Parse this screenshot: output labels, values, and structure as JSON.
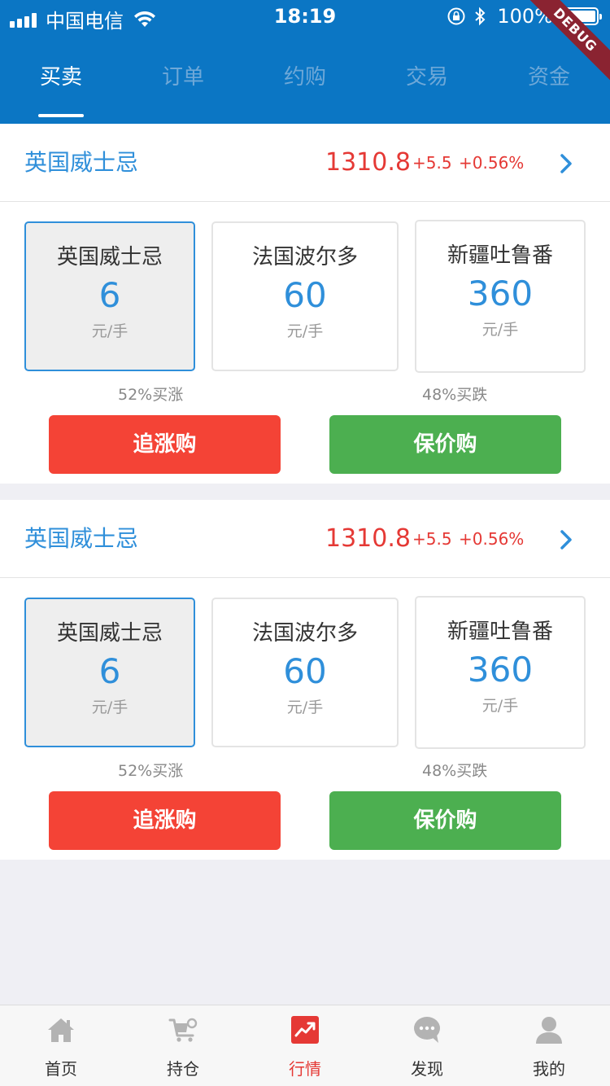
{
  "status_bar": {
    "carrier": "中国电信",
    "time": "18:19",
    "battery": "100%",
    "debug_label": "DEBUG"
  },
  "tabs": [
    {
      "label": "买卖",
      "active": true
    },
    {
      "label": "订单",
      "active": false
    },
    {
      "label": "约购",
      "active": false
    },
    {
      "label": "交易",
      "active": false
    },
    {
      "label": "资金",
      "active": false
    }
  ],
  "cards": [
    {
      "product": "英国威士忌",
      "price": "1310.8",
      "change": "+5.5",
      "change_pct": "+0.56%",
      "options": [
        {
          "name": "英国威士忌",
          "price": "6",
          "unit": "元/手",
          "selected": true
        },
        {
          "name": "法国波尔多",
          "price": "60",
          "unit": "元/手",
          "selected": false
        },
        {
          "name": "新疆吐鲁番",
          "price": "360",
          "unit": "元/手",
          "selected": false
        }
      ],
      "buy_up_ratio": "52%买涨",
      "buy_down_ratio": "48%买跌",
      "buy_up_button": "追涨购",
      "buy_down_button": "保价购"
    },
    {
      "product": "英国威士忌",
      "price": "1310.8",
      "change": "+5.5",
      "change_pct": "+0.56%",
      "options": [
        {
          "name": "英国威士忌",
          "price": "6",
          "unit": "元/手",
          "selected": true
        },
        {
          "name": "法国波尔多",
          "price": "60",
          "unit": "元/手",
          "selected": false
        },
        {
          "name": "新疆吐鲁番",
          "price": "360",
          "unit": "元/手",
          "selected": false
        }
      ],
      "buy_up_ratio": "52%买涨",
      "buy_down_ratio": "48%买跌",
      "buy_up_button": "追涨购",
      "buy_down_button": "保价购"
    }
  ],
  "bottom_nav": [
    {
      "label": "首页",
      "icon": "home-icon",
      "active": false
    },
    {
      "label": "持仓",
      "icon": "cart-icon",
      "active": false
    },
    {
      "label": "行情",
      "icon": "chart-icon",
      "active": true
    },
    {
      "label": "发现",
      "icon": "chat-bubble-icon",
      "active": false
    },
    {
      "label": "我的",
      "icon": "user-icon",
      "active": false
    }
  ],
  "colors": {
    "header_bg": "#0b76c4",
    "accent_blue": "#2f8fda",
    "price_red": "#e53935",
    "buy_up_red": "#f44336",
    "buy_down_green": "#4caf50"
  }
}
